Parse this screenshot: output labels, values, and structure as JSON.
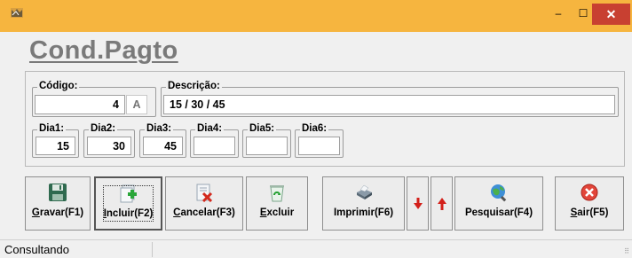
{
  "window": {
    "icon": "app-icon",
    "minimize_glyph": "–",
    "maximize_glyph": "☐",
    "close_glyph": "✕"
  },
  "form": {
    "title": "Cond.Pagto",
    "codigo": {
      "label": "Código:",
      "value": "4",
      "suffix": "A"
    },
    "descricao": {
      "label": "Descrição:",
      "value": "15 / 30 / 45"
    },
    "dias": [
      {
        "label": "Dia1:",
        "value": "15"
      },
      {
        "label": "Dia2:",
        "value": "30"
      },
      {
        "label": "Dia3:",
        "value": "45"
      },
      {
        "label": "Dia4:",
        "value": ""
      },
      {
        "label": "Dia5:",
        "value": ""
      },
      {
        "label": "Dia6:",
        "value": ""
      }
    ]
  },
  "toolbar": {
    "gravar": {
      "pre": "",
      "key": "G",
      "post": "ravar(F1)",
      "icon": "floppy-disk-icon"
    },
    "incluir": {
      "pre": "",
      "key": "I",
      "post": "ncluir(F2)",
      "icon": "add-document-icon"
    },
    "cancelar": {
      "pre": "",
      "key": "C",
      "post": "ancelar(F3)",
      "icon": "cancel-document-icon"
    },
    "excluir": {
      "pre": "",
      "key": "E",
      "post": "xcluir",
      "icon": "recycle-bin-icon"
    },
    "imprimir": {
      "label": "Imprimir(F6)",
      "icon": "printer-icon"
    },
    "prev": {
      "icon": "arrow-down-red-icon"
    },
    "next": {
      "icon": "arrow-up-red-icon"
    },
    "pesquisar": {
      "label": "Pesquisar(F4)",
      "icon": "search-globe-icon"
    },
    "sair": {
      "pre": "",
      "key": "S",
      "post": "air(F5)",
      "icon": "exit-icon"
    }
  },
  "status": {
    "text": "Consultando"
  }
}
